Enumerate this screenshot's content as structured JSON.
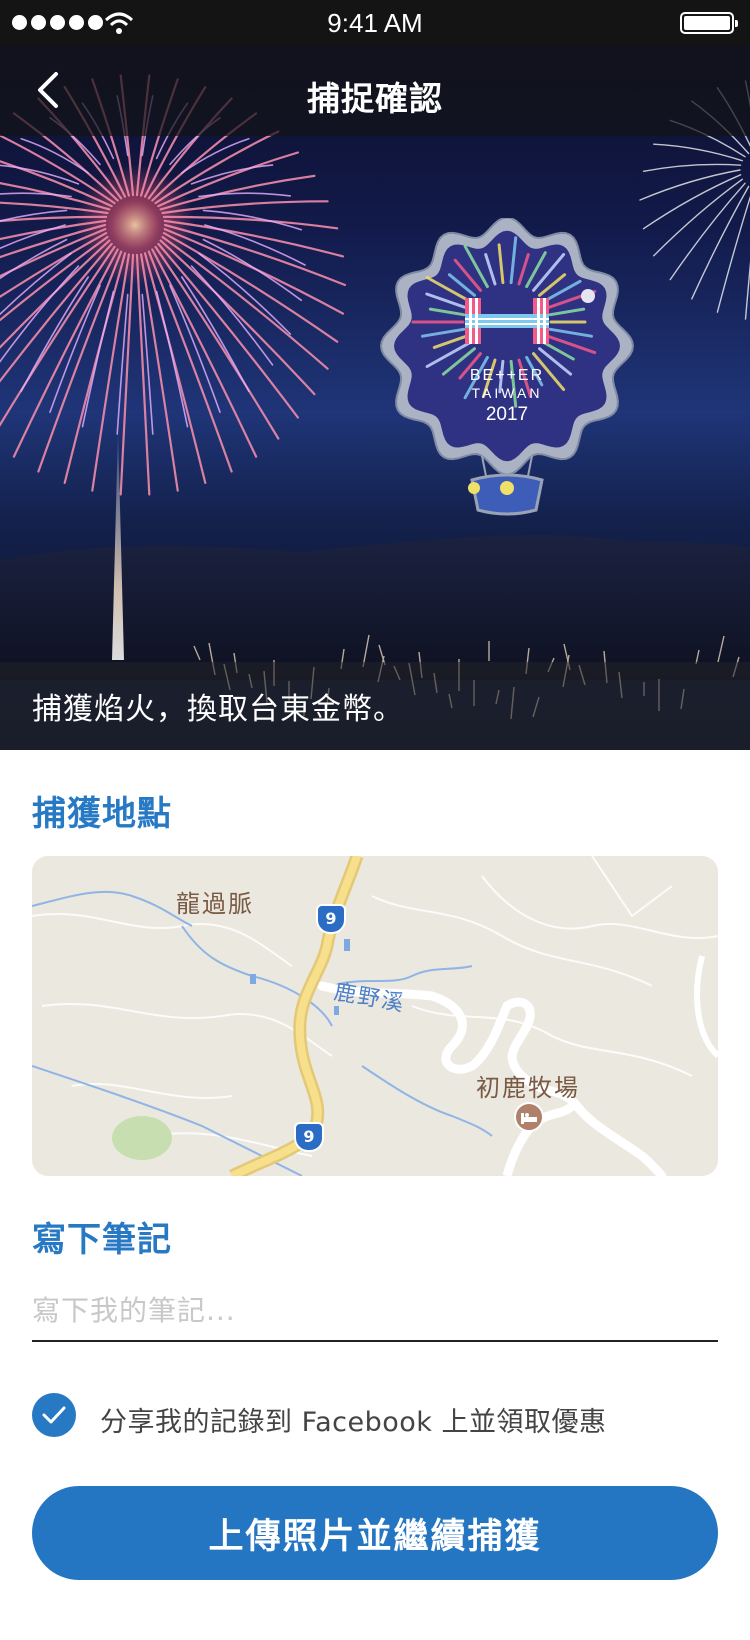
{
  "status_bar": {
    "time": "9:41 AM",
    "signal_icon": "signal-dots-icon",
    "wifi_icon": "wifi-icon",
    "battery_icon": "battery-icon"
  },
  "nav": {
    "title": "捕捉確認",
    "back_icon": "chevron-left-icon"
  },
  "hero": {
    "badge_text": [
      "BE++ER",
      "TAIWAN",
      "2017"
    ],
    "caption": "捕獲焰火，換取台東金幣。"
  },
  "location": {
    "title": "捕獲地點",
    "map_labels": {
      "village": "龍過脈",
      "river": "鹿野溪",
      "ranch": "初鹿牧場",
      "route_top": "9",
      "route_bottom": "9"
    }
  },
  "notes": {
    "title": "寫下筆記",
    "placeholder": "寫下我的筆記...",
    "value": ""
  },
  "share": {
    "checked": true,
    "label": "分享我的記錄到 Facebook 上並領取優惠"
  },
  "actions": {
    "upload_label": "上傳照片並繼續捕獲"
  },
  "colors": {
    "accent": "#2879c4",
    "button": "#2476c2",
    "status_bar": "#141414"
  }
}
